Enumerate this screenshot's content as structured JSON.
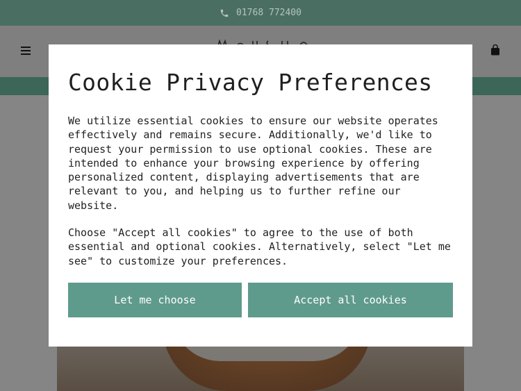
{
  "topbar": {
    "phone": "01768 772400",
    "phone_icon": "phone-icon"
  },
  "header": {
    "menu_icon": "hamburger-menu-icon",
    "bag_icon": "shopping-bag-icon",
    "logo_icon": "store-logo"
  },
  "modal": {
    "title": "Cookie Privacy Preferences",
    "paragraph1": "We utilize essential cookies to ensure our website operates effectively and remains secure. Additionally, we'd like to request your permission to use optional cookies. These are intended to enhance your browsing experience by offering personalized content, displaying advertisements that are relevant to you, and helping us to further refine our website.",
    "paragraph2": "Choose \"Accept all cookies\" to agree to the use of both essential and optional cookies. Alternatively, select \"Let me see\" to customize your preferences.",
    "choose_label": "Let me choose",
    "accept_label": "Accept all cookies"
  },
  "colors": {
    "accent": "#5f9b8c",
    "topbar": "#4a6e62",
    "overlay": "#7f7f7f"
  }
}
